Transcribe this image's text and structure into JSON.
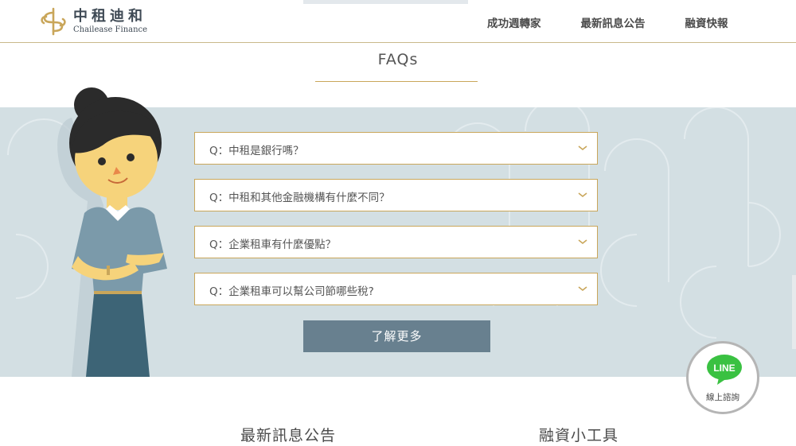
{
  "header": {
    "logo": {
      "name_cn": "中租迪和",
      "name_en": "Chailease Finance"
    },
    "nav": [
      {
        "label": "成功週轉家"
      },
      {
        "label": "最新訊息公告"
      },
      {
        "label": "融資快報"
      }
    ]
  },
  "faq": {
    "title": "FAQs",
    "items": [
      {
        "question": "Q：中租是銀行嗎？"
      },
      {
        "question": "Q：中租和其他金融機構有什麼不同？"
      },
      {
        "question": "Q：企業租車有什麼優點？"
      },
      {
        "question": "Q：企業租車可以幫公司節哪些稅?"
      }
    ],
    "more_label": "了解更多"
  },
  "line_widget": {
    "logo_text": "LINE",
    "label": "線上諮詢"
  },
  "sections": {
    "news_title": "最新訊息公告",
    "tools_title": "融資小工具"
  },
  "colors": {
    "accent_gold": "#c9a65a",
    "band_bg": "#d3dfe3",
    "button_slate": "#68808f",
    "line_green": "#3ac142",
    "dress_blue": "#3d6476"
  },
  "icons": {
    "faq_toggle": "chevron-down-icon",
    "line": "line-chat-icon"
  }
}
